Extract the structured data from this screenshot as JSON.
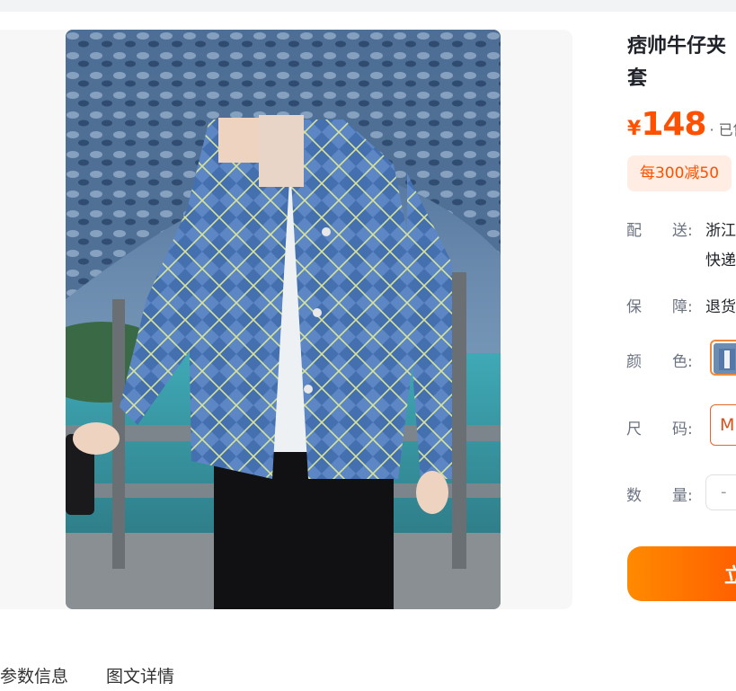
{
  "product": {
    "title": "痞帅牛仔夹套",
    "currency": "¥",
    "price": "148",
    "sold_prefix": "· 已售",
    "coupon": "每300减50",
    "image_label": "product-photo-denim-jacket"
  },
  "specs": {
    "delivery_label": "配　　送:",
    "delivery_value_line1": "浙江",
    "delivery_value_line2": "快递",
    "guarantee_label": "保　　障:",
    "guarantee_value": "退货",
    "color_label": "颜　　色:",
    "size_label": "尺　　码:",
    "size_value": "M",
    "quantity_label": "数　　量:",
    "quantity_minus": "-"
  },
  "tabs": {
    "params": "参数信息",
    "details": "图文详情"
  },
  "buy_button": {
    "label": "立"
  },
  "colors": {
    "accent": "#ff5000",
    "coupon_bg": "#ffece2",
    "panel_bg": "#f7f7f8"
  }
}
